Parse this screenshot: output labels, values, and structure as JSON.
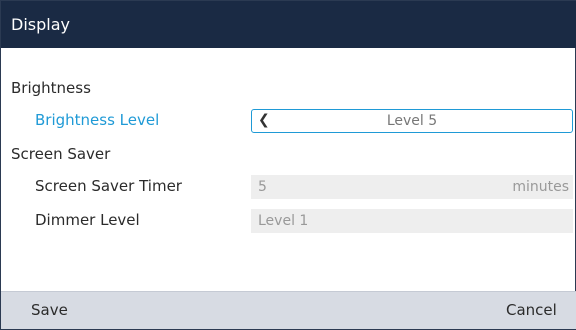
{
  "window": {
    "title": "Display"
  },
  "brightness": {
    "section_label": "Brightness",
    "level_label": "Brightness Level",
    "level_value": "Level 5"
  },
  "screen_saver": {
    "section_label": "Screen Saver",
    "timer_label": "Screen Saver Timer",
    "timer_value": "5",
    "timer_unit": "minutes",
    "dimmer_label": "Dimmer Level",
    "dimmer_value": "Level 1"
  },
  "softkeys": {
    "save": "Save",
    "cancel": "Cancel"
  },
  "colors": {
    "titlebar": "#1a2a44",
    "accent": "#1f9ad6",
    "softkey_bar": "#d7dbe3",
    "field_bg": "#eeeeee"
  },
  "icons": {
    "brightness_left": "chevron-left-icon"
  }
}
